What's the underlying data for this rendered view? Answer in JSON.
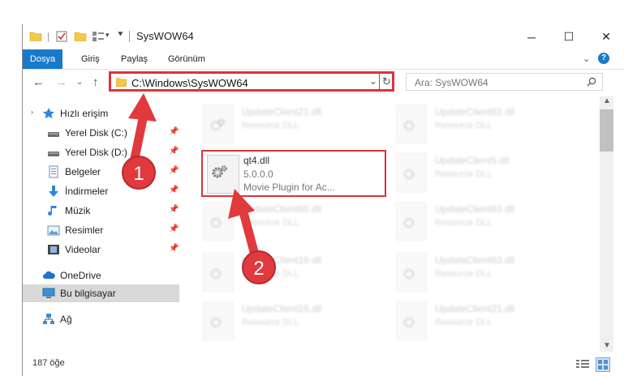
{
  "window": {
    "title": "SysWOW64",
    "controls": {
      "minimize": "─",
      "maximize": "☐",
      "close": "✕"
    }
  },
  "ribbon": {
    "tabs": [
      "Dosya",
      "Giriş",
      "Paylaş",
      "Görünüm"
    ],
    "expand_icon": "chevron-down-icon",
    "help_icon": "?"
  },
  "address": {
    "path": "C:\\Windows\\SysWOW64",
    "search_placeholder": "Ara: SysWOW64"
  },
  "sidebar": {
    "items": [
      {
        "label": "Hızlı erişim",
        "icon": "star-icon",
        "pinned": false
      },
      {
        "label": "Yerel Disk (C:)",
        "icon": "drive-icon",
        "pinned": true
      },
      {
        "label": "Yerel Disk (D:)",
        "icon": "drive-icon",
        "pinned": true
      },
      {
        "label": "Belgeler",
        "icon": "documents-icon",
        "pinned": true
      },
      {
        "label": "İndirmeler",
        "icon": "download-icon",
        "pinned": true
      },
      {
        "label": "Müzik",
        "icon": "music-icon",
        "pinned": true
      },
      {
        "label": "Resimler",
        "icon": "pictures-icon",
        "pinned": true
      },
      {
        "label": "Videolar",
        "icon": "videos-icon",
        "pinned": true
      },
      {
        "label": "OneDrive",
        "icon": "cloud-icon",
        "pinned": false
      },
      {
        "label": "Bu bilgisayar",
        "icon": "computer-icon",
        "pinned": false,
        "selected": true
      },
      {
        "label": "Ağ",
        "icon": "network-icon",
        "pinned": false
      }
    ]
  },
  "files": {
    "left_column": [
      {
        "name": "UpdateClient21.dll",
        "desc": "Resource DLL"
      },
      {
        "name": "UpdateClient65.dll",
        "desc": "Resource DLL"
      },
      {
        "name": "UpdateClient19.dll",
        "desc": "Resource DLL"
      },
      {
        "name": "UpdateClient19.dll",
        "desc": "Resource DLL"
      }
    ],
    "right_column": [
      {
        "name": "UpdateClient63.dll",
        "desc": "Resource DLL"
      },
      {
        "name": "UpdateClient5.dll",
        "desc": "Resource DLL"
      },
      {
        "name": "UpdateClient63.dll",
        "desc": "Resource DLL"
      },
      {
        "name": "UpdateClient63.dll",
        "desc": "Resource DLL"
      },
      {
        "name": "UpdateClient21.dll",
        "desc": "Resource DLL"
      }
    ],
    "highlighted": {
      "name": "qt4.dll",
      "version": "5.0.0.0",
      "description": "Movie Plugin for Ac..."
    }
  },
  "status": {
    "count": "187 öğe"
  },
  "annotations": {
    "step1": "1",
    "step2": "2",
    "color": "#e0393e"
  }
}
